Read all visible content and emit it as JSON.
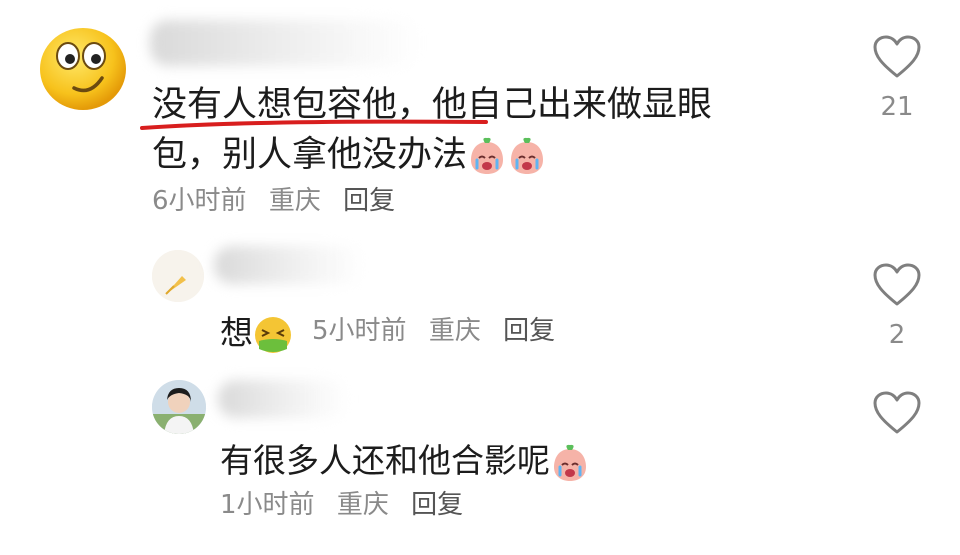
{
  "comments": {
    "main": {
      "text_line1": "没有人想包容他，他自己出来做显眼",
      "text_line2": "包，别人拿他没办法",
      "time": "6小时前",
      "location": "重庆",
      "reply_label": "回复",
      "like_count": "21",
      "avatar_icon": "smiling-face-emoji",
      "trailing_emoji": "crying-peach-emoji",
      "underline_color": "#d81e1e"
    },
    "replies": [
      {
        "text": "想",
        "emoji": "nauseated-face-emoji",
        "time": "5小时前",
        "location": "重庆",
        "reply_label": "回复",
        "like_count": "2"
      },
      {
        "text": "有很多人还和他合影呢",
        "emoji": "crying-peach-emoji",
        "time": "1小时前",
        "location": "重庆",
        "reply_label": "回复",
        "like_count": ""
      }
    ]
  },
  "colors": {
    "text": "#1c1c1c",
    "meta": "#8a8a8a",
    "icon": "#7f7f7f"
  }
}
